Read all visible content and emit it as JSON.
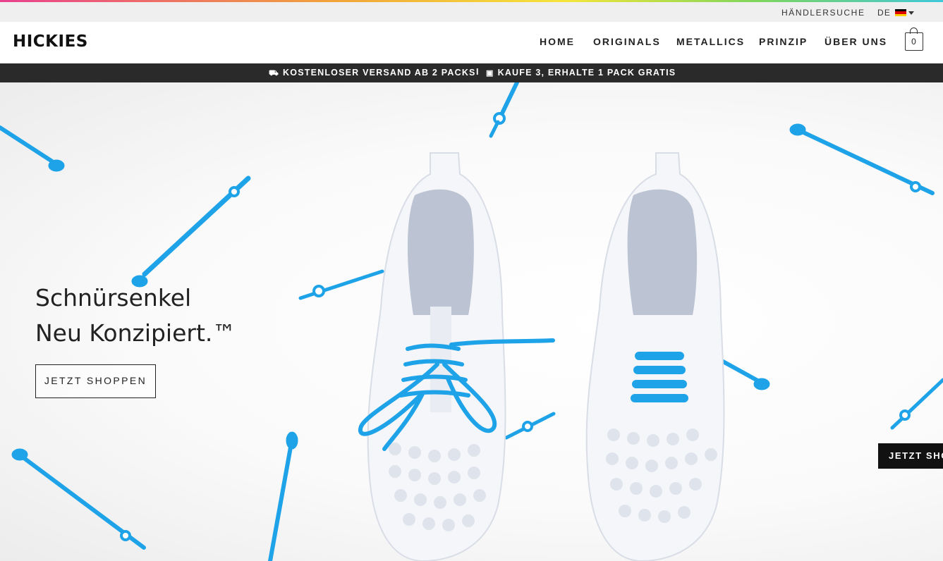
{
  "colors": {
    "accent_blue": "#1fa3e8",
    "promo_bg": "#2a2a2a",
    "util_bg": "#efefef",
    "flag": [
      "#000000",
      "#dd0000",
      "#ffce00"
    ]
  },
  "utility": {
    "dealer_search": "HÄNDLERSUCHE",
    "language": "DE",
    "flag_icon": "flag-de-icon"
  },
  "header": {
    "logo": "HICKIES",
    "nav": [
      "HOME",
      "ORIGINALS",
      "METALLICS",
      "PRINZIP",
      "ÜBER UNS"
    ],
    "cart_count": "0",
    "cart_icon": "shopping-bag-icon"
  },
  "promo": {
    "shipping_icon": "truck-icon",
    "shipping": "KOSTENLOSER VERSAND AB 2 PACKS",
    "separator": "I",
    "gift_icon": "gift-icon",
    "offer": "KAUFE 3, ERHALTE 1 PACK GRATIS"
  },
  "hero": {
    "headline_line1": "Schnürsenkel",
    "headline_line2": "Neu Konzipiert.™",
    "cta": "JETZT SHOPPEN",
    "side_cta": "JETZT SHOPPEN"
  }
}
